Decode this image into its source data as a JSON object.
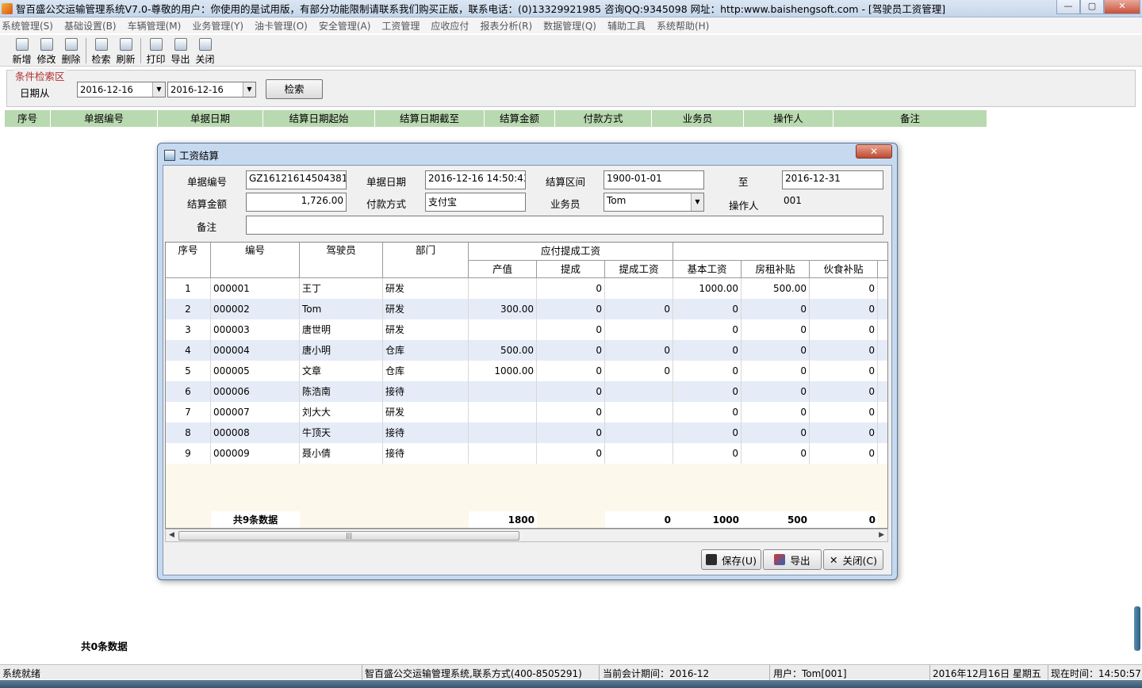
{
  "window": {
    "title": "智百盛公交运输管理系统V7.0-尊敬的用户：你使用的是试用版，有部分功能限制请联系我们购买正版，联系电话：(0)13329921985 咨询QQ:9345098 网址：http:www.baishengsoft.com - [驾驶员工资管理]",
    "min": "—",
    "max": "▢",
    "close": "✕"
  },
  "menu": [
    "系统管理(S)",
    "基础设置(B)",
    "车辆管理(M)",
    "业务管理(Y)",
    "油卡管理(O)",
    "安全管理(A)",
    "工资管理",
    "应收应付",
    "报表分析(R)",
    "数据管理(Q)",
    "辅助工具",
    "系统帮助(H)"
  ],
  "toolbar": {
    "group1": [
      "新增",
      "修改",
      "删除"
    ],
    "group2": [
      "检索",
      "刷新"
    ],
    "group3": [
      "打印",
      "导出",
      "关闭"
    ]
  },
  "search": {
    "legend": "条件检索区",
    "date_from_label": "日期从",
    "date_from": "2016-12-16",
    "date_to": "2016-12-16",
    "search_button": "检索"
  },
  "main_table": {
    "headers": [
      "序号",
      "单据编号",
      "单据日期",
      "结算日期起始",
      "结算日期截至",
      "结算金额",
      "付款方式",
      "业务员",
      "操作人",
      "备注"
    ],
    "footer": "共0条数据"
  },
  "dialog": {
    "title": "工资结算",
    "close_label": "✕",
    "labels": {
      "doc_no": "单据编号",
      "doc_date": "单据日期",
      "period": "结算区间",
      "to": "至",
      "amount": "结算金额",
      "payment": "付款方式",
      "salesman": "业务员",
      "operator": "操作人",
      "remark": "备注"
    },
    "values": {
      "doc_no": "GZ16121614504381",
      "doc_date": "2016-12-16 14:50:43",
      "period_start": "1900-01-01",
      "period_end": "2016-12-31",
      "amount": "1,726.00",
      "payment": "支付宝",
      "salesman": "Tom",
      "operator": "001",
      "remark": ""
    },
    "grid": {
      "group_header": "应付提成工资",
      "headers": [
        "序号",
        "编号",
        "驾驶员",
        "部门",
        "产值",
        "提成",
        "提成工资",
        "基本工资",
        "房租补贴",
        "伙食补贴"
      ],
      "rows": [
        [
          "1",
          "000001",
          "王丁",
          "研发",
          "",
          "0",
          "",
          "1000.00",
          "500.00",
          "0"
        ],
        [
          "2",
          "000002",
          "Tom",
          "研发",
          "300.00",
          "0",
          "0",
          "0",
          "0",
          "0"
        ],
        [
          "3",
          "000003",
          "唐世明",
          "研发",
          "",
          "0",
          "",
          "0",
          "0",
          "0"
        ],
        [
          "4",
          "000004",
          "唐小明",
          "仓库",
          "500.00",
          "0",
          "0",
          "0",
          "0",
          "0"
        ],
        [
          "5",
          "000005",
          "文章",
          "仓库",
          "1000.00",
          "0",
          "0",
          "0",
          "0",
          "0"
        ],
        [
          "6",
          "000006",
          "陈浩南",
          "接待",
          "",
          "0",
          "",
          "0",
          "0",
          "0"
        ],
        [
          "7",
          "000007",
          "刘大大",
          "研发",
          "",
          "0",
          "",
          "0",
          "0",
          "0"
        ],
        [
          "8",
          "000008",
          "牛顶天",
          "接待",
          "",
          "0",
          "",
          "0",
          "0",
          "0"
        ],
        [
          "9",
          "000009",
          "聂小倩",
          "接待",
          "",
          "0",
          "",
          "0",
          "0",
          "0"
        ]
      ],
      "summary": {
        "count": "共9条数据",
        "output": "1800",
        "commission_wage": "0",
        "base_wage": "1000",
        "rent": "500",
        "meal": "0"
      }
    },
    "buttons": {
      "save": "保存(U)",
      "export": "导出",
      "close": "关闭(C)"
    }
  },
  "status": {
    "ready": "系统就绪",
    "company": "智百盛公交运输管理系统,联系方式(400-8505291)",
    "period": "当前会计期间：2016-12",
    "user": "用户：Tom[001]",
    "date": "2016年12月16日 星期五",
    "time": "现在时间：14:50:57"
  }
}
